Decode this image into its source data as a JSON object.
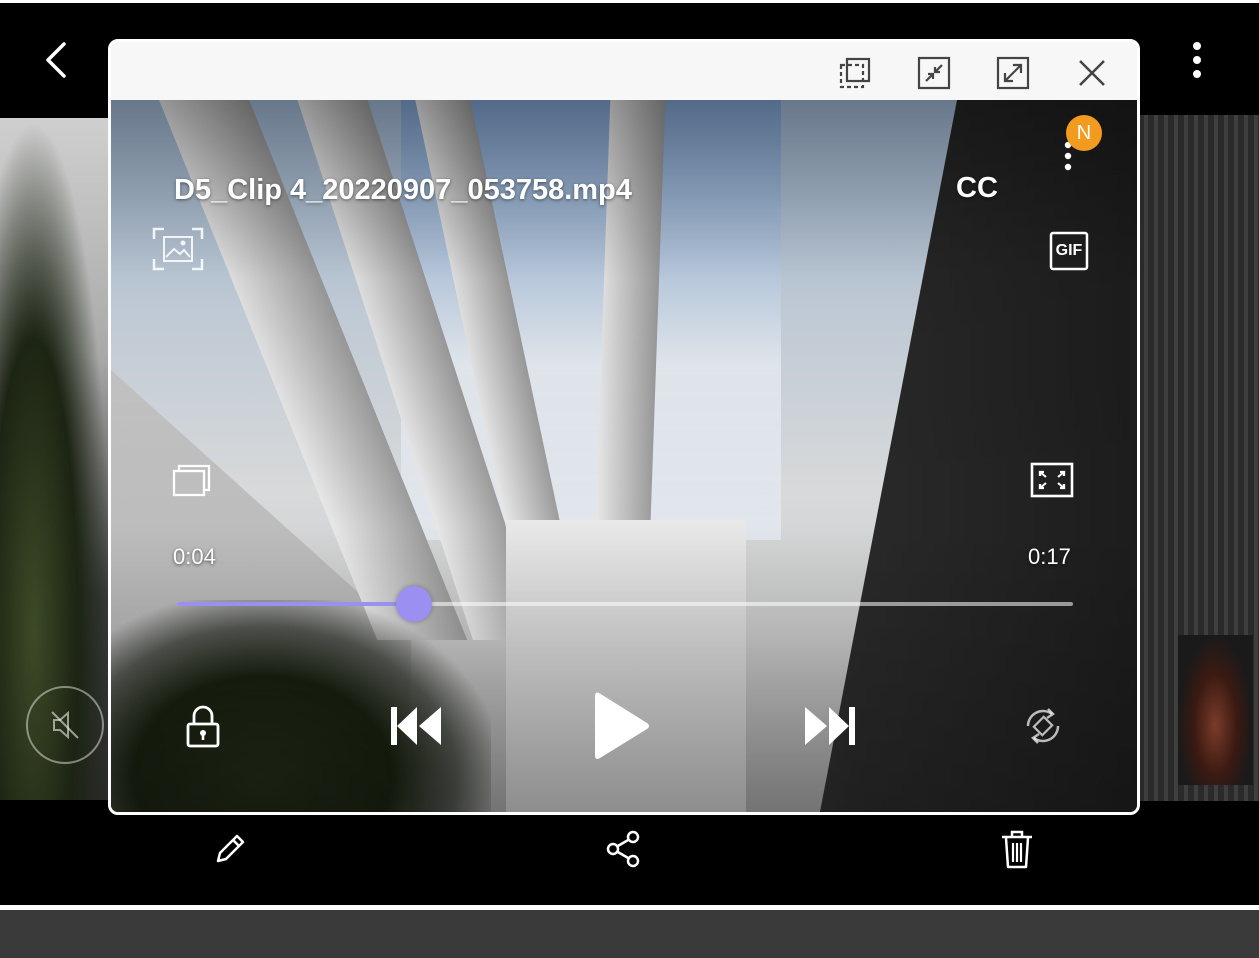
{
  "player": {
    "title": "D5_Clip 4_20220907_053758.mp4",
    "cc_label": "CC",
    "badge_letter": "N",
    "gif_label": "GIF",
    "current_time": "0:04",
    "total_time": "0:17",
    "progress_fraction": 0.265,
    "accent_color": "#9b8ff2",
    "badge_color": "#f39b1f"
  },
  "icons": {
    "back": "chevron-left-icon",
    "more": "more-vertical-icon",
    "mute": "speaker-mute-icon",
    "edit": "pencil-icon",
    "share": "share-icon",
    "delete": "trash-icon",
    "header": [
      "pop-out-icon",
      "minimize-icon",
      "maximize-icon",
      "close-icon"
    ],
    "capture": "capture-image-icon",
    "gif": "gif-icon",
    "layers": "popup-play-icon",
    "fullscreen": "fullscreen-icon",
    "lock": "lock-icon",
    "prev": "skip-previous-icon",
    "play": "play-icon",
    "next": "skip-next-icon",
    "rotate": "auto-rotate-icon"
  }
}
